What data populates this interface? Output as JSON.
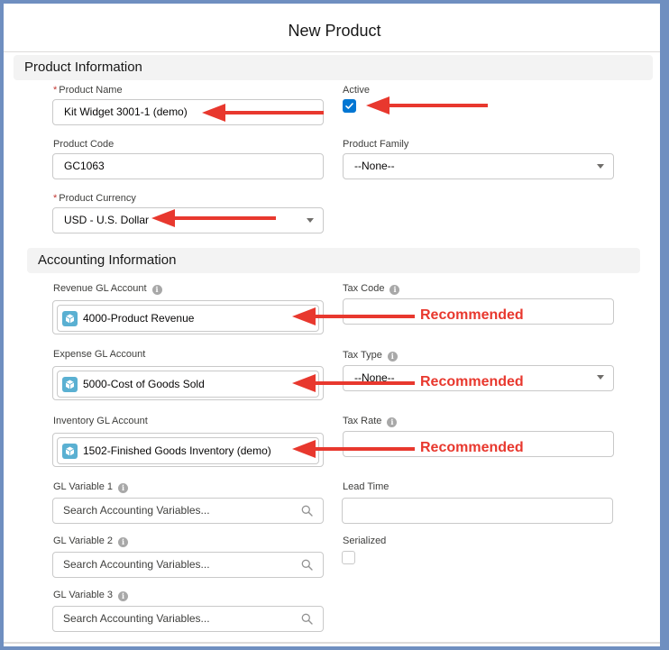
{
  "modal": {
    "title": "New Product"
  },
  "product_information": {
    "header": "Product Information",
    "product_name": {
      "label": "Product Name",
      "required_mark": "*",
      "value": "Kit Widget 3001-1 (demo)"
    },
    "active": {
      "label": "Active",
      "checked": true
    },
    "product_code": {
      "label": "Product Code",
      "value": "GC1063"
    },
    "product_family": {
      "label": "Product Family",
      "value": "--None--"
    },
    "product_currency": {
      "label": "Product Currency",
      "required_mark": "*",
      "value": "USD - U.S. Dollar"
    }
  },
  "accounting_information": {
    "header": "Accounting Information",
    "revenue_gl": {
      "label": "Revenue GL Account",
      "value": "4000-Product Revenue"
    },
    "tax_code": {
      "label": "Tax Code",
      "value": ""
    },
    "expense_gl": {
      "label": "Expense GL Account",
      "value": "5000-Cost of Goods Sold"
    },
    "tax_type": {
      "label": "Tax Type",
      "value": "--None--"
    },
    "inventory_gl": {
      "label": "Inventory GL Account",
      "value": "1502-Finished Goods Inventory (demo)"
    },
    "tax_rate": {
      "label": "Tax Rate",
      "value": ""
    },
    "gl_variable_1": {
      "label": "GL Variable 1",
      "placeholder": "Search Accounting Variables..."
    },
    "lead_time": {
      "label": "Lead Time",
      "value": ""
    },
    "gl_variable_2": {
      "label": "GL Variable 2",
      "placeholder": "Search Accounting Variables..."
    },
    "serialized": {
      "label": "Serialized",
      "checked": false
    },
    "gl_variable_3": {
      "label": "GL Variable 3",
      "placeholder": "Search Accounting Variables..."
    }
  },
  "annotations": {
    "recommended_label": "Recommended",
    "arrow_color": "#e8382e"
  },
  "icons": {
    "info": "info-icon",
    "search": "search-icon",
    "lookup": "gl-account-icon",
    "caret": "chevron-down-icon",
    "check": "check-icon"
  }
}
